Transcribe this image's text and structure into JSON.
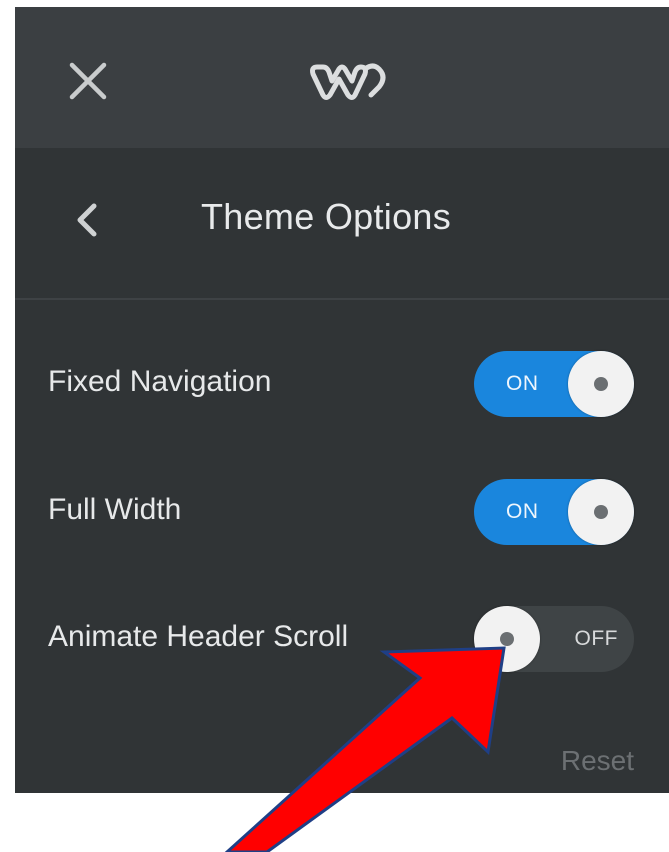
{
  "header": {
    "close_icon": "close-icon",
    "logo_icon": "weebly-logo"
  },
  "panel": {
    "back_icon": "chevron-left-icon",
    "title": "Theme Options"
  },
  "options": [
    {
      "label": "Fixed Navigation",
      "state": "ON",
      "enabled": true
    },
    {
      "label": "Full Width",
      "state": "ON",
      "enabled": true
    },
    {
      "label": "Animate Header Scroll",
      "state": "OFF",
      "enabled": false
    }
  ],
  "footer": {
    "reset_label": "Reset"
  },
  "colors": {
    "panel_bg": "#303436",
    "topbar_bg": "#3b3f42",
    "toggle_on": "#1a86dd",
    "toggle_off": "#3f4446",
    "annotation_arrow": "#ff0000"
  }
}
